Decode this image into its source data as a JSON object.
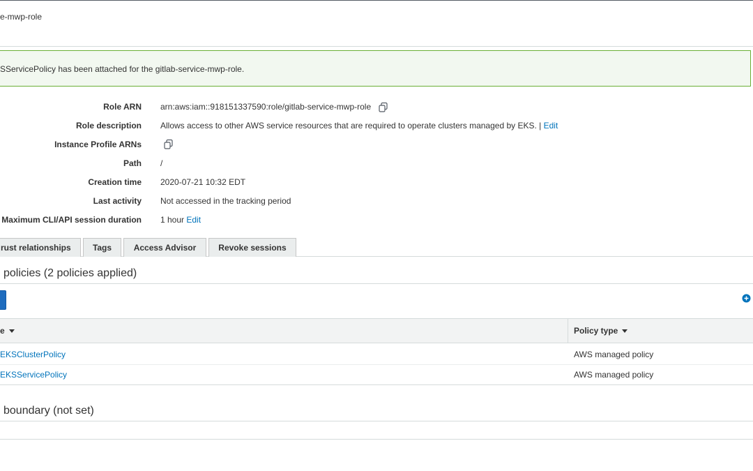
{
  "header": {
    "breadcrumb_tail": "e-mwp-role"
  },
  "flash": {
    "message": "SServicePolicy has been attached for the gitlab-service-mwp-role."
  },
  "summary": {
    "role_arn_label": "Role ARN",
    "role_arn_value": "arn:aws:iam::918151337590:role/gitlab-service-mwp-role",
    "role_description_label": "Role description",
    "role_description_value": "Allows access to other AWS service resources that are required to operate clusters managed by EKS. |",
    "role_description_edit": "Edit",
    "instance_profile_label": "Instance Profile ARNs",
    "path_label": "Path",
    "path_value": "/",
    "creation_time_label": "Creation time",
    "creation_time_value": "2020-07-21 10:32 EDT",
    "last_activity_label": "Last activity",
    "last_activity_value": "Not accessed in the tracking period",
    "max_session_label": "Maximum CLI/API session duration",
    "max_session_value": "1 hour",
    "max_session_edit": "Edit"
  },
  "tabs": [
    {
      "label": "rust relationships"
    },
    {
      "label": "Tags"
    },
    {
      "label": "Access Advisor"
    },
    {
      "label": "Revoke sessions"
    }
  ],
  "permissions": {
    "title": "policies (2 policies applied)",
    "columns": {
      "name": "e",
      "policy_type": "Policy type"
    },
    "rows": [
      {
        "name": "EKSClusterPolicy",
        "type": "AWS managed policy"
      },
      {
        "name": "EKSServicePolicy",
        "type": "AWS managed policy"
      }
    ]
  },
  "boundary": {
    "title": "boundary (not set)"
  },
  "colors": {
    "link": "#0073bb",
    "success_border": "#6aaf35",
    "success_bg": "#f2f8f0",
    "primary_button": "#1e6cbe"
  },
  "icons": {
    "copy": "copy-icon",
    "add": "add-circle-icon",
    "sort": "caret-down-icon"
  }
}
